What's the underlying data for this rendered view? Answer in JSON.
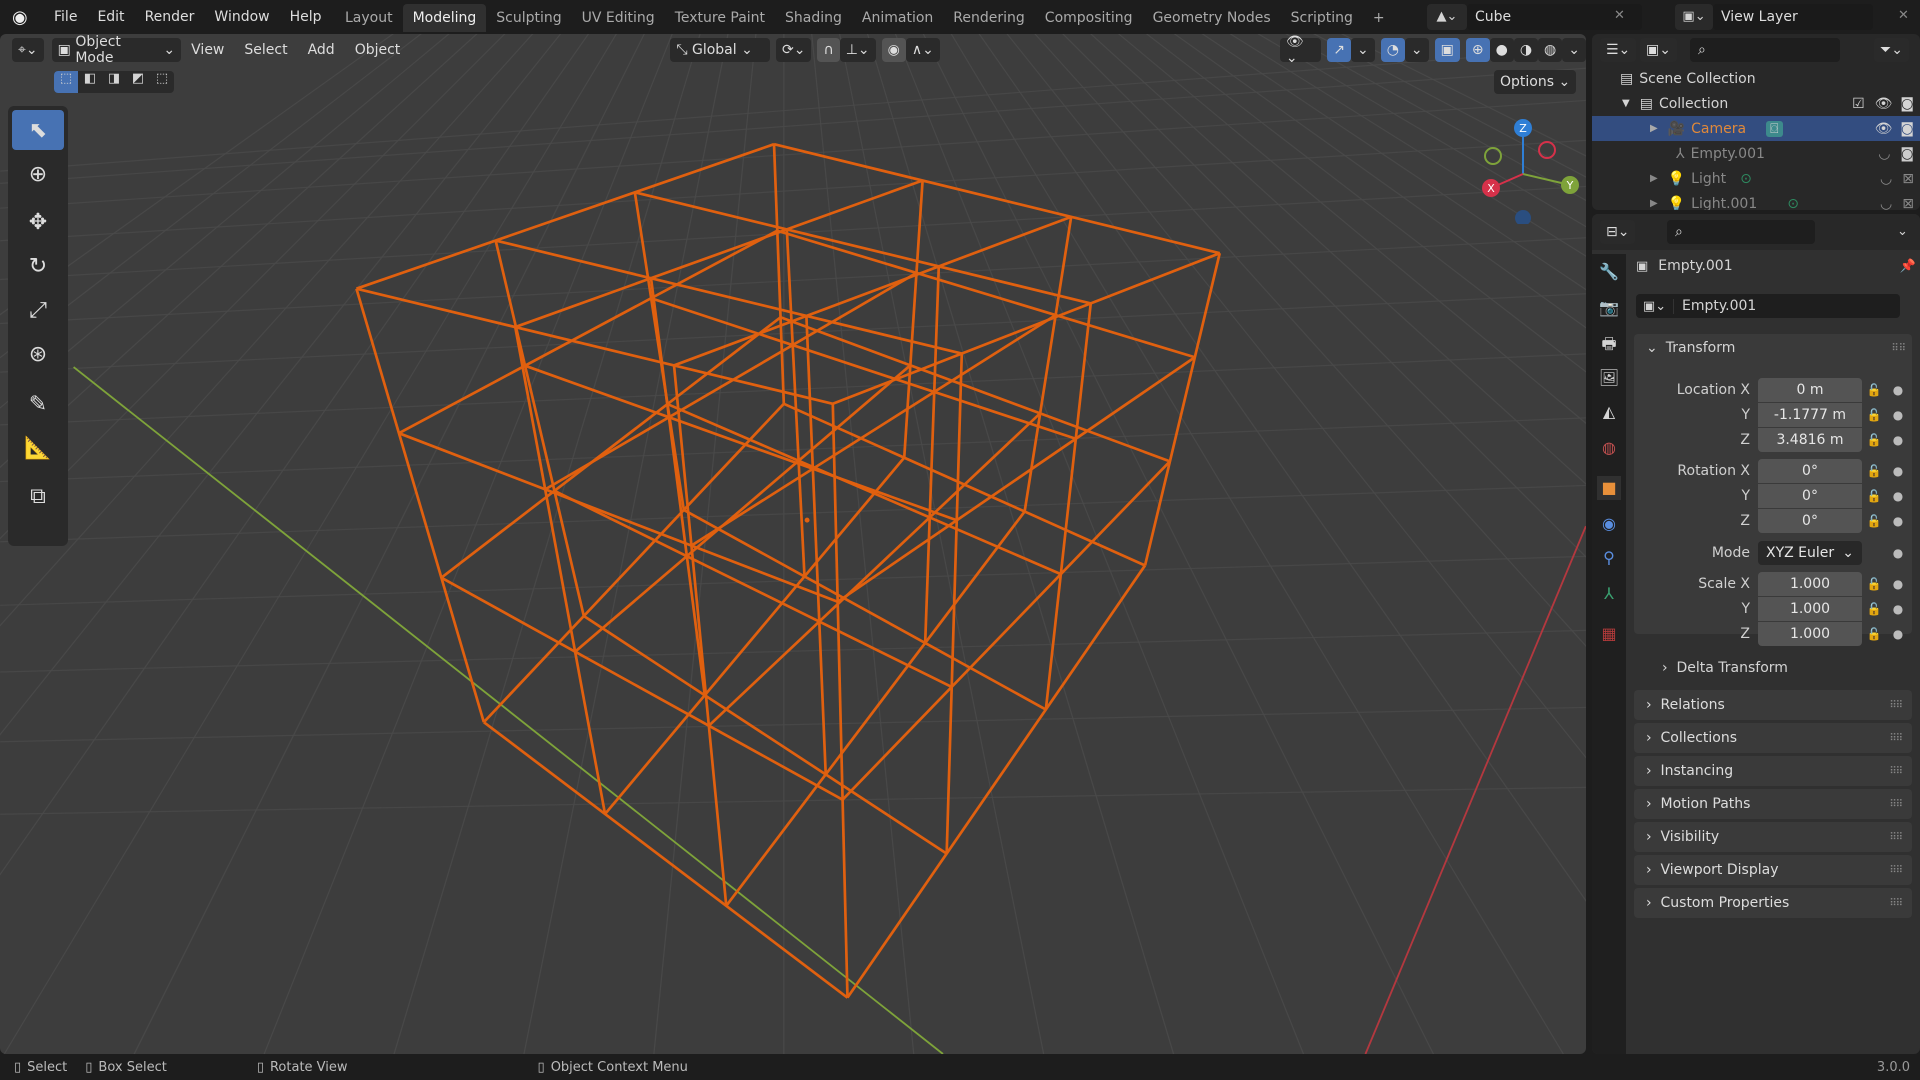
{
  "topbar": {
    "menus": [
      "File",
      "Edit",
      "Render",
      "Window",
      "Help"
    ],
    "workspaces": [
      "Layout",
      "Modeling",
      "Sculpting",
      "UV Editing",
      "Texture Paint",
      "Shading",
      "Animation",
      "Rendering",
      "Compositing",
      "Geometry Nodes",
      "Scripting"
    ],
    "active_workspace": "Modeling",
    "add_tab": "+",
    "scene": "Cube",
    "view_layer": "View Layer"
  },
  "viewport": {
    "mode": "Object Mode",
    "menus": [
      "View",
      "Select",
      "Add",
      "Object"
    ],
    "orientation": "Global",
    "options": "Options",
    "gizmo": {
      "x": "X",
      "y": "Y",
      "z": "Z"
    },
    "colors": {
      "selection": "#e0600f",
      "x_axis": "#b3383f",
      "y_axis": "#7ea33a",
      "background": "#3d3d3d"
    }
  },
  "outliner": {
    "root": "Scene Collection",
    "collection": "Collection",
    "items": [
      {
        "name": "Camera",
        "selected": true
      },
      {
        "name": "Empty.001"
      },
      {
        "name": "Light"
      },
      {
        "name": "Light.001"
      }
    ]
  },
  "properties": {
    "object_name": "Empty.001",
    "name_field": "Empty.001",
    "transform_header": "Transform",
    "location": {
      "label": "Location X",
      "x": "0 m",
      "y": "-1.1777 m",
      "z": "3.4816 m"
    },
    "rotation": {
      "label": "Rotation X",
      "x": "0°",
      "y": "0°",
      "z": "0°"
    },
    "mode": {
      "label": "Mode",
      "value": "XYZ Euler"
    },
    "scale": {
      "label": "Scale X",
      "x": "1.000",
      "y": "1.000",
      "z": "1.000"
    },
    "axis_labels": {
      "y": "Y",
      "z": "Z"
    },
    "delta": "Delta Transform",
    "sections": [
      "Relations",
      "Collections",
      "Instancing",
      "Motion Paths",
      "Visibility",
      "Viewport Display",
      "Custom Properties"
    ]
  },
  "status": {
    "select": "Select",
    "box_select": "Box Select",
    "rotate": "Rotate View",
    "context": "Object Context Menu",
    "version": "3.0.0"
  }
}
